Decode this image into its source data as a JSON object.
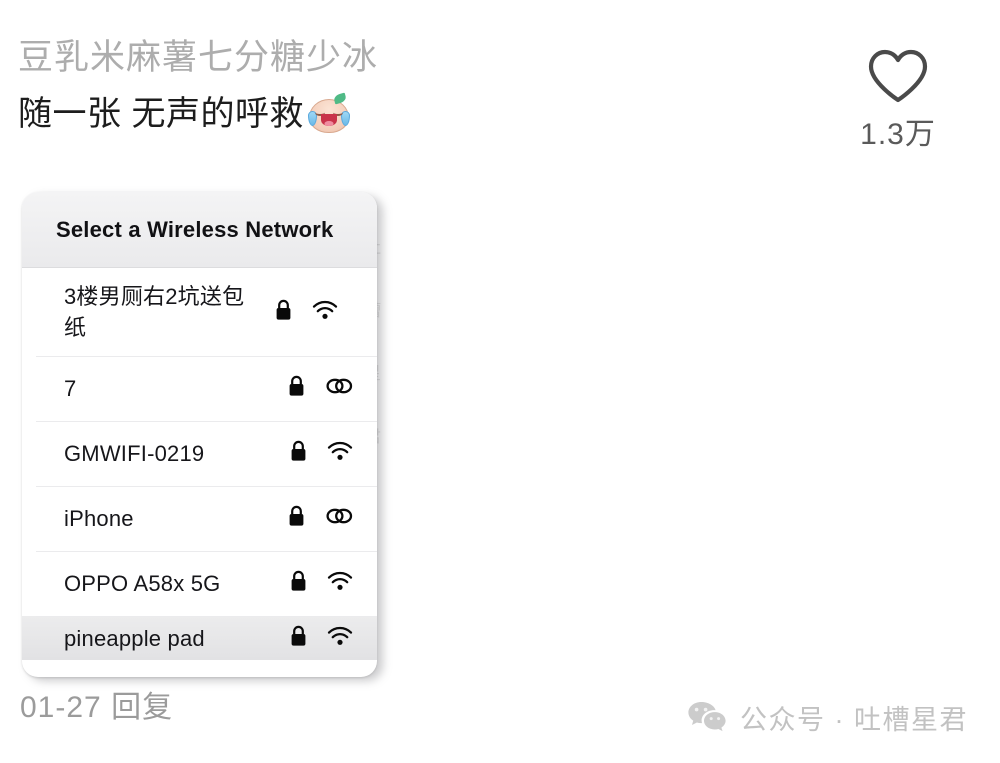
{
  "post": {
    "username": "豆乳米麻薯七分糖少冰",
    "message": "随一张 无声的呼救",
    "emoji_name": "crying-laughing-face-emoji",
    "reply_meta": "01-27 回复"
  },
  "like": {
    "icon": "heart-outline-icon",
    "count": "1.3万"
  },
  "background_watermark": "吐槽星君",
  "wifi_dialog": {
    "title": "Select a Wireless Network",
    "networks": [
      {
        "ssid": "3楼男厕右2坑送包纸",
        "secured": true,
        "lock_icon": "lock-icon",
        "signal_icon": "wifi-icon",
        "two_line": true,
        "dimmed": false
      },
      {
        "ssid": "7",
        "secured": true,
        "lock_icon": "lock-icon",
        "signal_icon": "hotspot-icon",
        "two_line": false,
        "dimmed": false
      },
      {
        "ssid": "GMWIFI-0219",
        "secured": true,
        "lock_icon": "lock-icon",
        "signal_icon": "wifi-icon",
        "two_line": false,
        "dimmed": false
      },
      {
        "ssid": "iPhone",
        "secured": true,
        "lock_icon": "lock-icon",
        "signal_icon": "hotspot-icon",
        "two_line": false,
        "dimmed": false
      },
      {
        "ssid": "OPPO A58x 5G",
        "secured": true,
        "lock_icon": "lock-icon",
        "signal_icon": "wifi-icon",
        "two_line": false,
        "dimmed": false
      },
      {
        "ssid": "pineapple pad",
        "secured": true,
        "lock_icon": "lock-icon",
        "signal_icon": "wifi-icon",
        "two_line": false,
        "dimmed": true
      }
    ]
  },
  "watermark": {
    "icon": "wechat-logo-icon",
    "text": "公众号 · 吐槽星君"
  },
  "colors": {
    "username": "#adadad",
    "body_text": "#1d1d1d",
    "meta_text": "#9b9b9b",
    "watermark_text": "#c2c2c2",
    "card_header_bg": "#eeeef0",
    "page_bg": "#ffffff"
  }
}
